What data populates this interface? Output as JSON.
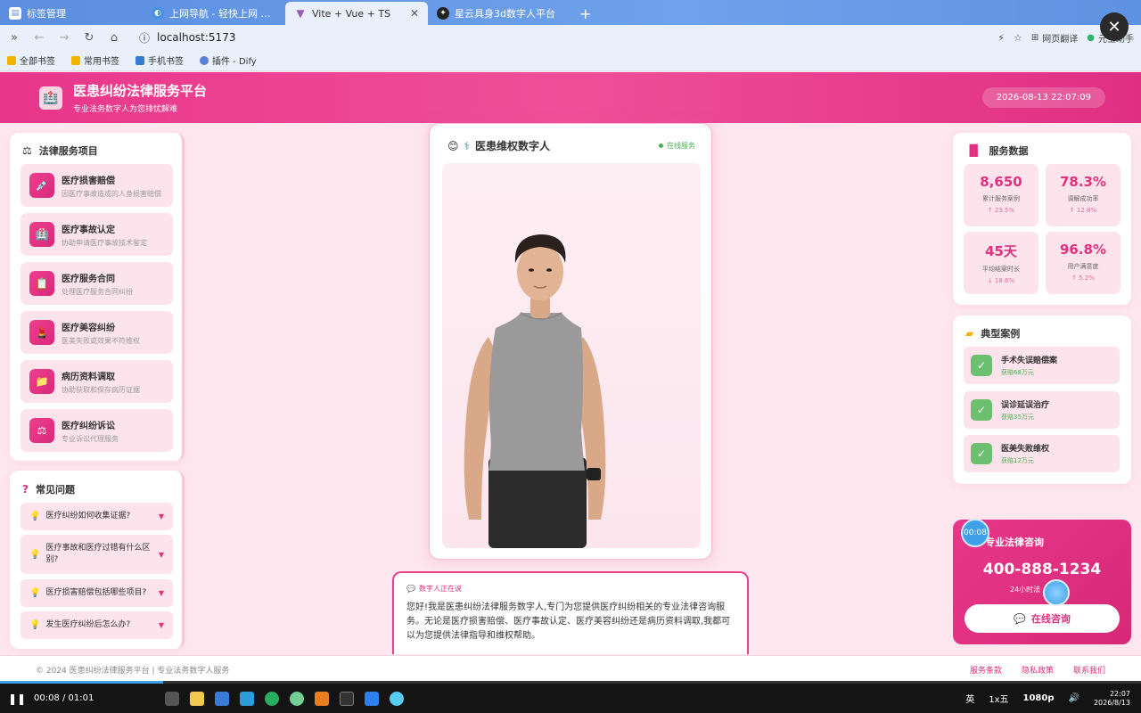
{
  "browser": {
    "tabs": [
      {
        "label": "标签管理",
        "color": "#ffffff",
        "active": false
      },
      {
        "label": "上网导航 - 轻快上网 从这里开始",
        "color": "#4a90e2",
        "active": false
      },
      {
        "label": "Vite + Vue + TS",
        "color": "#9b59b6",
        "active": true
      },
      {
        "label": "星云具身3d数字人平台",
        "color": "#222222",
        "active": false
      }
    ],
    "url": "localhost:5173",
    "translate": "网页翻译",
    "assistant": "元宝助手",
    "bookmarks": [
      {
        "label": "全部书签",
        "color": "#f5b400"
      },
      {
        "label": "常用书签",
        "color": "#f5b400"
      },
      {
        "label": "手机书签",
        "color": "#3a7bd5"
      },
      {
        "label": "插件 - Dify",
        "color": "#5a7fd6"
      }
    ]
  },
  "header": {
    "title": "医患纠纷法律服务平台",
    "subtitle": "专业法务数字人为您排忧解难",
    "datetime": "2026-08-13 22:07:09"
  },
  "services": {
    "title": "法律服务项目",
    "items": [
      {
        "title": "医疗损害赔偿",
        "desc": "因医疗事故造成的人身损害赔偿",
        "icon": "💉"
      },
      {
        "title": "医疗事故认定",
        "desc": "协助申请医疗事故技术鉴定",
        "icon": "🏥"
      },
      {
        "title": "医疗服务合同",
        "desc": "处理医疗服务合同纠纷",
        "icon": "📋"
      },
      {
        "title": "医疗美容纠纷",
        "desc": "医美失败或效果不符维权",
        "icon": "💄"
      },
      {
        "title": "病历资料调取",
        "desc": "协助获取和保存病历证据",
        "icon": "📁"
      },
      {
        "title": "医疗纠纷诉讼",
        "desc": "专业诉讼代理服务",
        "icon": "⚖"
      }
    ]
  },
  "faq": {
    "title": "常见问题",
    "items": [
      {
        "q": "医疗纠纷如何收集证据?"
      },
      {
        "q": "医疗事故和医疗过错有什么区别?"
      },
      {
        "q": "医疗损害赔偿包括哪些项目?"
      },
      {
        "q": "发生医疗纠纷后怎么办?"
      }
    ]
  },
  "avatar": {
    "title": "医患维权数字人",
    "status": "在线服务"
  },
  "speech": {
    "tag": "数字人正在说",
    "text": "您好!我是医患纠纷法律服务数字人,专门为您提供医疗纠纷相关的专业法律咨询服务。无论是医疗损害赔偿、医疗事故认定、医疗美容纠纷还是病历资料调取,我都可以为您提供法律指导和维权帮助。"
  },
  "stats": {
    "title": "服务数据",
    "items": [
      {
        "value": "8,650",
        "label": "累计服务案例",
        "trend": "↑ 23.5%"
      },
      {
        "value": "78.3%",
        "label": "调解成功率",
        "trend": "↑ 12.8%"
      },
      {
        "value": "45天",
        "label": "平均结案时长",
        "trend": "↓ 18.6%"
      },
      {
        "value": "96.8%",
        "label": "用户满意度",
        "trend": "↑ 5.2%"
      }
    ]
  },
  "cases": {
    "title": "典型案例",
    "items": [
      {
        "title": "手术失误赔偿案",
        "result": "获赔68万元"
      },
      {
        "title": "误诊延误治疗",
        "result": "获赔35万元"
      },
      {
        "title": "医美失败维权",
        "result": "获赔12万元"
      }
    ]
  },
  "consult": {
    "title": "专业法律咨询",
    "phone": "400-888-1234",
    "sub": "24小时法",
    "button": "在线咨询"
  },
  "recording": {
    "time": "00:08"
  },
  "footer": {
    "copyright": "© 2024 医患纠纷法律服务平台 | 专业法务数字人服务",
    "links": [
      "服务条款",
      "隐私政策",
      "联系我们"
    ]
  },
  "player": {
    "time": "00:08 / 01:01",
    "progress": 0.143,
    "quality": "1080p",
    "ime": "英",
    "speed": "1x五",
    "clock_time": "22:07",
    "clock_date": "2026/8/13"
  }
}
